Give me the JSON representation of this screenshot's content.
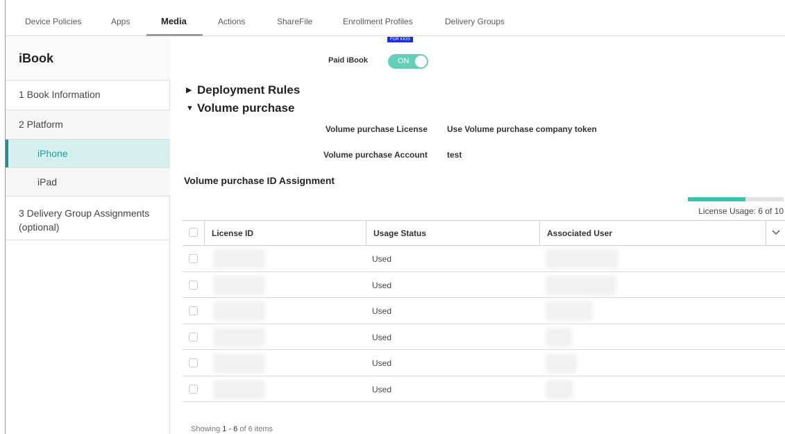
{
  "topnav": {
    "tabs": [
      {
        "label": "Device Policies"
      },
      {
        "label": "Apps"
      },
      {
        "label": "Media"
      },
      {
        "label": "Actions"
      },
      {
        "label": "ShareFile"
      },
      {
        "label": "Enrollment Profiles"
      },
      {
        "label": "Delivery Groups"
      }
    ],
    "active_tab": "Media"
  },
  "sidebar": {
    "title": "iBook",
    "items": [
      {
        "label": "1  Book Information"
      },
      {
        "label": "2  Platform"
      },
      {
        "label": "iPhone"
      },
      {
        "label": "iPad"
      },
      {
        "label": "3  Delivery Group Assignments (optional)"
      }
    ],
    "active_item": "iPhone"
  },
  "main": {
    "kiosk_badge": "FOR KIOS",
    "paid_ibook": {
      "label": "Paid iBook",
      "toggle": "ON"
    },
    "sections": {
      "deployment_rules": "Deployment Rules",
      "volume_purchase": "Volume purchase"
    },
    "volume_purchase_license": {
      "label": "Volume purchase License",
      "value": "Use Volume purchase company token"
    },
    "volume_purchase_account": {
      "label": "Volume purchase Account",
      "value": "test"
    },
    "assignment_title": "Volume purchase ID Assignment",
    "license_usage": {
      "text": "License Usage: 6 of 10",
      "used": 6,
      "total": 10
    },
    "table": {
      "columns": [
        "License ID",
        "Usage Status",
        "Associated User"
      ],
      "rows": [
        {
          "status": "Used"
        },
        {
          "status": "Used"
        },
        {
          "status": "Used"
        },
        {
          "status": "Used"
        },
        {
          "status": "Used"
        },
        {
          "status": "Used"
        }
      ]
    },
    "footer": {
      "prefix": "Showing",
      "range": "1 - 6",
      "suffix": "of 6 items"
    }
  },
  "colors": {
    "accent": "#1f9e9e",
    "toggle_on": "#62cfb6",
    "usage_fill": "#3fbfb0",
    "active_bg": "#d6efef"
  },
  "icons": [
    "chevron-down-icon",
    "triangle-right-icon",
    "triangle-down-icon",
    "checkbox-icon"
  ]
}
